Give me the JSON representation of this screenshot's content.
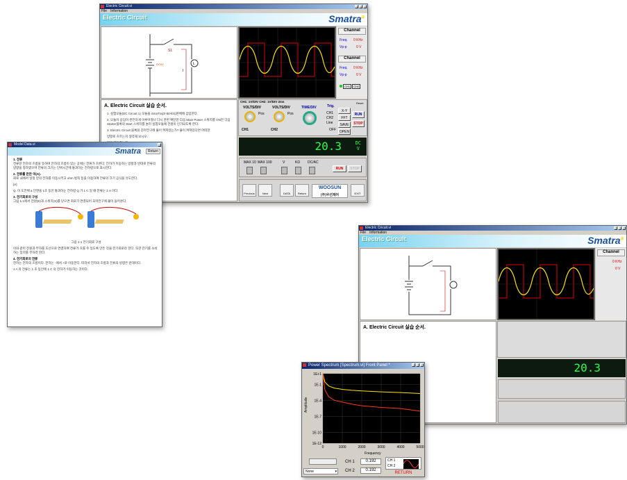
{
  "main_window": {
    "title": "Electric Circuit.vi",
    "menu": [
      "File",
      "Information"
    ],
    "app_title": "Electric Circuit",
    "logo": "Smatra",
    "logo_mark": "a",
    "channel_title": "Channel",
    "freq_label": "Freq.",
    "freq_value": "0 KHz",
    "vpp_label": "Vp-p",
    "vpp_value": "0 V",
    "scope_status": "CH1:      1V/DIV  CH2:      1V/DIV          2ms",
    "volts_div": "VOLTS/DIV",
    "time_div": "TIME/DIV",
    "trig": "Trig.",
    "trig_options": [
      "CH1",
      "CH2",
      "Line"
    ],
    "ch1": "CH1",
    "ch2": "CH2",
    "pos": "Pos",
    "off": "OFF",
    "side_buttons": [
      "X-Y",
      "FFT",
      "SAVE",
      "OPEN"
    ],
    "run": "RUN",
    "stop": "STOP",
    "reset": "Reset",
    "ch_tags": [
      "CH1",
      "CH2"
    ],
    "meter_value": "20.3",
    "meter_unit": "DC\nV",
    "switch_labels": [
      "MAX 10",
      "MAX 100",
      "V",
      "KΩ",
      "DC/AC"
    ],
    "nav": [
      "Previous",
      "Next",
      "DATA",
      "Return",
      "EXIT"
    ],
    "woosun": "WOOSUN",
    "woosun_kr": "(주)우선제어",
    "circuit": {
      "switch": "S1",
      "battery": "DC5V",
      "lamp": "L",
      "current": "I"
    },
    "doc_title": "A. Electric Circuit 실습 순서.",
    "doc_lines": [
      "1. 실험모듈(DC Circuit 1) 모듈을 SmaTra(S-50-ES)본체에 삽입한다.",
      "2. 모듈이 삽입이 완전하게 이루어졌나 다시 한번 확인한 다음 Main Power 스위치를 ON한 다음 Starter블록의 Start 스위치를 눌러 실험모듈에 전원이 인가되도록 한다.",
      "3. Electric Circuit 블록의 김마전구에 불이 켜져있는가? 불이 켜져있다면 어떠한",
      "                                                   방향로 흐르는지 생각해 보시오.",
      "                                                   적을 해야하는가?",
      "                                                   림을 의무고 회로에서 미포발스위치를 D)",
      "                                                   어떠한가?"
    ]
  },
  "second_window": {
    "title": "Electric Circuit.vi",
    "menu": [
      "File",
      "Information"
    ],
    "app_title": "Electric Circuit",
    "logo": "Smatra",
    "logo_mark": "a",
    "channel_title": "Channel",
    "freq_value": "0 KHz",
    "vpp_value": "0 V",
    "meter_value": "20.3",
    "doc_title": "A. Electric Circuit 실습 순서."
  },
  "model_window": {
    "title": "Model Data.vi",
    "logo": "Smatra",
    "return": "Return",
    "sections": [
      {
        "h": "1. 전류",
        "t": "전류란 전하의 흐름을 뜻하며 전하의 흐름이 있는 곳에는 전류가 흐른다. 전하가 이동하는 방향과 반대로 전류의 방향을 정하였으며 전류의 크기는 단위시간에 통과하는 전하량으로 표시한다."
      },
      {
        "h": "2. 전류를 만든 이(A).",
        "t": "회로 내에서 일정 양의 전하를 이동시키고 ohm 법칙 등을 이용하여 전류의 크기 공식을 유도한다."
      },
      {
        "h": "",
        "t": "[A]"
      },
      {
        "h": "",
        "t": "Q. 이 도전체 a 단면을 1초 동안 통과하는 전하량 Q 가 1 C 일 때 전류는 1 A 이다."
      },
      {
        "h": "3. 전기회로의 구성",
        "t": "그림 1-1에서 전원(E)과 스위치(S)를 닫으면 회로가 연결되어 꼬마전구에 불이 들어온다."
      },
      {
        "h": "",
        "t": "그림 1-1 전기회로 구성"
      },
      {
        "h": "",
        "t": "이와 같이 전원과 부하를 도선으로 연결하여 전류가 흐를 수 있도록 만든 것을 전기회로라 한다. 또한 전기를 소비하는 장치를 부하라 한다."
      },
      {
        "h": "4. 전기회로의 전류",
        "t": "전자는 전자의 흐름이다. 전자는 -에서 +로 이동한다. 따라서 전자의 흐름과 전류의 방향은 반대이다."
      },
      {
        "h": "",
        "t": "1 A 의 전류는 1 초 동안에 1 C 의 전하가 이동하는 것이다."
      }
    ]
  },
  "spectrum_window": {
    "title": "Power Spectrum [Spectrum.vi] Front Panel *",
    "y_label": "Amplitude",
    "x_label": "Frequency",
    "y_ticks": [
      "1E+1",
      "1E-1",
      "1E-4",
      "1E-7",
      "1E-10",
      "1E-12"
    ],
    "x_ticks": [
      "0",
      "1000",
      "2000",
      "3000",
      "4000",
      "5000"
    ],
    "ch1_label": "CH 1",
    "ch1_value": "0.192",
    "ch2_label": "CH 2",
    "ch2_value": "0.192",
    "none": "None",
    "return": "RETURN",
    "legend": [
      "CH 1",
      "CH 2"
    ]
  },
  "chart_data": {
    "type": "line",
    "x": [
      0,
      100,
      300,
      600,
      1000,
      1500,
      2000,
      3000,
      4000,
      5000
    ],
    "series": [
      {
        "name": "CH 1",
        "values": [
          10,
          0.3,
          0.05,
          0.02,
          0.012,
          0.008,
          0.006,
          0.004,
          0.003,
          0.002
        ]
      },
      {
        "name": "CH 2",
        "values": [
          10,
          0.01,
          0.0005,
          0.0001,
          5e-05,
          2e-05,
          1e-05,
          5e-06,
          3e-06,
          1e-06
        ]
      }
    ],
    "title": "",
    "xlabel": "Frequency",
    "ylabel": "Amplitude",
    "xlim": [
      0,
      5000
    ],
    "ylim": [
      1e-12,
      10
    ],
    "y_scale": "log",
    "colors": {
      "CH 1": "#ffe600",
      "CH 2": "#ff3a1a"
    }
  }
}
